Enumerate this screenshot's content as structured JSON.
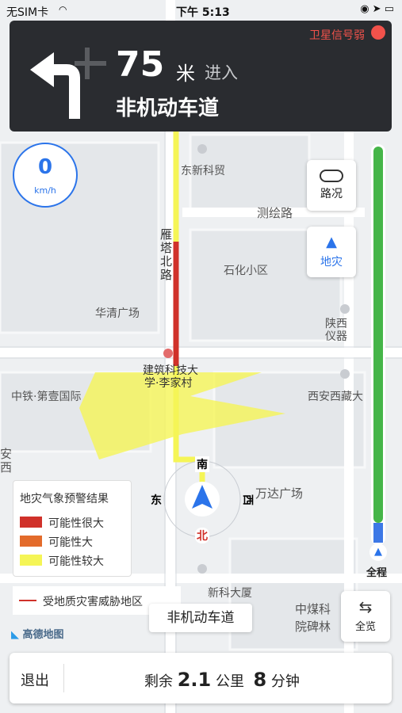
{
  "status_bar": {
    "carrier": "无SIM卡",
    "time": "下午 5:13"
  },
  "navigation": {
    "turn_icon": "turn-left-icon",
    "distance": "75",
    "distance_unit": "米",
    "action": "进入",
    "next_road": "非机动车道",
    "gps_status": "卫星信号弱"
  },
  "speed": {
    "value": "0",
    "unit": "km/h"
  },
  "side_buttons": {
    "traffic": "路况",
    "disaster": "地灾"
  },
  "map": {
    "labels": {
      "dongke": "东新科贸",
      "cehui": "测绘路",
      "shihua": "石化小区",
      "huaqing": "华清广场",
      "jianzhu": "建筑科技大",
      "jianzhu2": "学·李家村",
      "zhongtie": "中铁·第壹国际",
      "xian": "西安西藏大",
      "wanda": "万达广场",
      "zhongmei": "中煤科",
      "zhongmei2": "院碑林",
      "yanta": "雁塔北路",
      "shanxi": "陕西",
      "shanxi2": "仪器",
      "kemao": "新科大厦",
      "nan": "南",
      "dong": "东",
      "xi": "西",
      "bei": "北",
      "anxi": "安西"
    }
  },
  "legend": {
    "title": "地灾气象预警结果",
    "items": [
      {
        "label": "可能性很大",
        "color": "#d0312a"
      },
      {
        "label": "可能性大",
        "color": "#e36b2b"
      },
      {
        "label": "可能性较大",
        "color": "#f5f556"
      }
    ],
    "threat_label": "受地质灾害威胁地区",
    "threat_color": "#d0312a"
  },
  "current_road": "非机动车道",
  "brand": "高德地图",
  "progress": {
    "label": "全程",
    "completed_fraction": 0.05
  },
  "overview": {
    "label": "全览"
  },
  "bottom_bar": {
    "exit": "退出",
    "remain_prefix": "剩余",
    "remain_distance": "2.1",
    "remain_distance_unit": "公里",
    "remain_time": "8",
    "remain_time_unit": "分钟"
  }
}
